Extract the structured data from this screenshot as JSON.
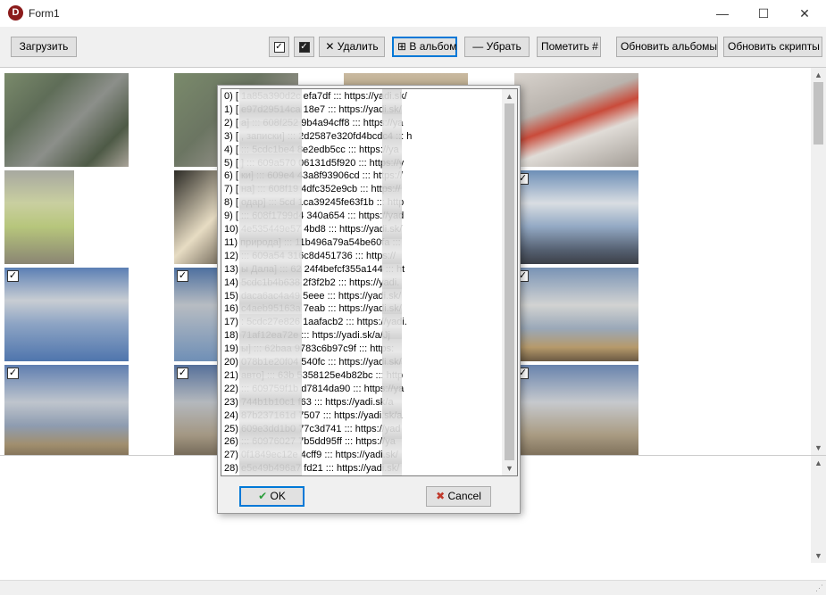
{
  "window": {
    "title": "Form1",
    "icon_letter": "D",
    "minimize": "—",
    "maximize": "☐",
    "close": "✕"
  },
  "toolbar": {
    "load": "Загрузить",
    "check_all": "✓",
    "check_dark": "✓",
    "delete": "✕ Удалить",
    "to_album": "⊞ В альбом",
    "remove": "— Убрать",
    "mark": "Пометить #",
    "refresh_albums": "Обновить альбомы",
    "refresh_scripts": "Обновить скрипты"
  },
  "check_mark": "✓",
  "list_items": [
    "0) [ 1a85a390d2c efa7df ::: https://yadi.sk/",
    "1) [ e97d29514ca 18e7 ::: https://yadi.sk/",
    "2) [ а] ::: 608f252 9b4a94cff8 ::: https://ya",
    "3) [ , записки] ::: 2d2587e320fd4bcdc4 ::: h",
    "4) [ ::: 5cdc1be4 8e2edb5cc ::: https://ya",
    "5) [ ] ::: 609a570 06131d5f920 ::: https://y",
    "6) [ ки] ::: 609e4 43a8f93906cd ::: https://",
    "7) [ на] ::: 608f19 4dfc352e9cb ::: https://",
    "8) [ одар] ::: 5cd 1ca39245fe63f1b ::: http",
    "9) [ ::: 608f1799d4 340a654 ::: https://yad",
    "10) 4e535449e57 4bd8 ::: https://yadi.sk/",
    "11) природа] ::: 11b496a79a54be60fa :::",
    "12) ::: 609a54 316c8d451736 ::: https://",
    "13) ы Дала] ::: 62 24f4befcf355a144 ::: ht",
    "14) 5cdc1b4b638 2f3f2b2 ::: https://yadi.",
    "15) daca6ac4a49 5eee ::: https://yadi.sk/",
    "16) c4aeb95163a 7eab ::: https://yadi.sk/",
    "17) : 5cdc27e826 1aafacb2 ::: https://yadi.",
    "18) 71af12ea72e ::: https://yadi.sk/a/Jj",
    "19) ы] ::: 62baa 9783c6b97c9f ::: https:",
    "20) 078b1e20f04 540fc ::: https://yadi.sk/",
    "21) авто] ::: 63b 5358125e4b82bc ::: http",
    "22) ::: 609759f1b d7814da90 ::: https://ya",
    "23) 744b1b10c1 f63 ::: https://yadi.sk/a",
    "24) 87b237161d 7507 ::: https://yadi.sk/a",
    "25) 609e3dd1b0 77c3d741 ::: https://yad",
    "26) ::: 60976027 7b5dd95ff ::: https://ya",
    "27) 0f1849ec12e 4cff9 ::: https://yadi.sk/",
    "28) e5e49b496a7 fd21 ::: https://yadi.sk/"
  ],
  "dialog": {
    "ok": "OK",
    "cancel": "Cancel",
    "ok_icon": "✔",
    "cancel_icon": "✖"
  },
  "scroll": {
    "up": "▲",
    "down": "▼"
  },
  "status": {
    "grip": "⋰"
  }
}
